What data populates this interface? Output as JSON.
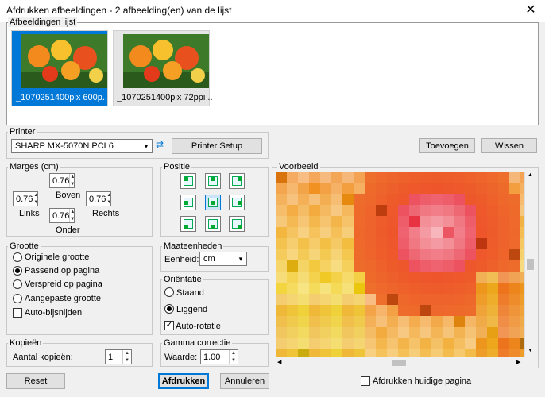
{
  "window": {
    "title": "Afdrukken afbeeldingen  -  2 afbeelding(en) van de lijst"
  },
  "images_list": {
    "label": "Afbeeldingen lijst",
    "items": [
      {
        "caption": "_1070251400pix 600p..."
      },
      {
        "caption": "_1070251400pix 72ppi ..."
      }
    ]
  },
  "printer": {
    "label": "Printer",
    "selected": "SHARP MX-5070N PCL6",
    "setup_label": "Printer Setup"
  },
  "actions": {
    "add_label": "Toevoegen",
    "remove_label": "Wissen",
    "reset_label": "Reset",
    "print_label": "Afdrukken",
    "cancel_label": "Annuleren",
    "print_current_label": "Afdrukken huidige pagina"
  },
  "margins": {
    "label": "Marges (cm)",
    "top": "0.76",
    "top_label": "Boven",
    "left": "0.76",
    "left_label": "Links",
    "right": "0.76",
    "right_label": "Rechts",
    "bottom": "0.76",
    "bottom_label": "Onder"
  },
  "position": {
    "label": "Positie"
  },
  "size": {
    "label": "Grootte",
    "options": [
      "Originele grootte",
      "Passend op pagina",
      "Verspreid op pagina",
      "Aangepaste grootte"
    ],
    "selected": 1,
    "autocrop_label": "Auto-bijsnijden"
  },
  "units": {
    "label": "Maateenheden",
    "field_label": "Eenheid:",
    "value": "cm"
  },
  "orientation": {
    "label": "Oriëntatie",
    "portrait_label": "Staand",
    "landscape_label": "Liggend",
    "autorotate_label": "Auto-rotatie",
    "selected": "landscape",
    "autorotate": true
  },
  "copies": {
    "label": "Kopieën",
    "field_label": "Aantal kopieën:",
    "value": "1"
  },
  "gamma": {
    "label": "Gamma correctie",
    "field_label": "Waarde:",
    "value": "1.00"
  },
  "preview": {
    "label": "Voorbeeld"
  },
  "colors": {
    "accent": "#0078d7",
    "selection": "#0078d7"
  }
}
